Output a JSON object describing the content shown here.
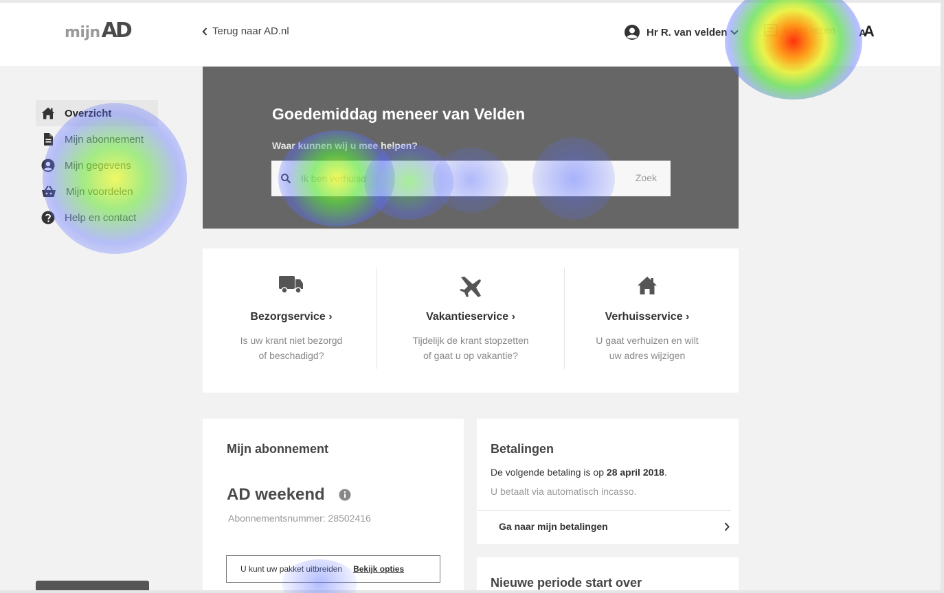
{
  "header": {
    "logo_mijn": "mijn",
    "logo_ad": "AD",
    "back_label": "Terug naar AD.nl",
    "user_name": "Hr R. van velden",
    "krant_label": "Krant lezen",
    "font_size_label_big": "A",
    "font_size_label_small": "A"
  },
  "sidebar": {
    "items": [
      {
        "label": "Overzicht",
        "icon": "home-icon",
        "active": true
      },
      {
        "label": "Mijn abonnement",
        "icon": "document-icon",
        "active": false
      },
      {
        "label": "Mijn gegevens",
        "icon": "user-icon",
        "active": false
      },
      {
        "label": "Mijn voordelen",
        "icon": "basket-icon",
        "active": false
      },
      {
        "label": "Help en contact",
        "icon": "help-icon",
        "active": false
      }
    ]
  },
  "hero": {
    "greeting": "Goedemiddag meneer van Velden",
    "question": "Waar kunnen wij u mee helpen?",
    "search_placeholder": "Ik ben verhuisd",
    "search_button": "Zoek"
  },
  "services": [
    {
      "title": "Bezorgservice",
      "desc1": "Is uw krant niet bezorgd",
      "desc2": "of beschadigd?",
      "icon": "truck-icon"
    },
    {
      "title": "Vakantieservice",
      "desc1": "Tijdelijk de krant stopzetten",
      "desc2": "of gaat u op vakantie?",
      "icon": "plane-icon"
    },
    {
      "title": "Verhuisservice",
      "desc1": "U gaat verhuizen en wilt",
      "desc2": "uw adres wijzigen",
      "icon": "house-icon"
    }
  ],
  "subscription": {
    "title": "Mijn abonnement",
    "plan": "AD weekend",
    "number": "Abonnementsnummer: 28502416",
    "extend_text": "U kunt uw pakket uitbreiden",
    "extend_link": "Bekijk opties"
  },
  "payments": {
    "title": "Betalingen",
    "next_prefix": "De volgende betaling is op ",
    "next_date": "28 april 2018",
    "next_suffix": ".",
    "method": "U betaalt via automatisch incasso.",
    "link": "Ga naar mijn betalingen"
  },
  "period": {
    "title": "Nieuwe periode start over"
  },
  "colors": {
    "hero_bg": "#666666",
    "page_bg": "#f2f2f2",
    "accent": "#333333"
  }
}
